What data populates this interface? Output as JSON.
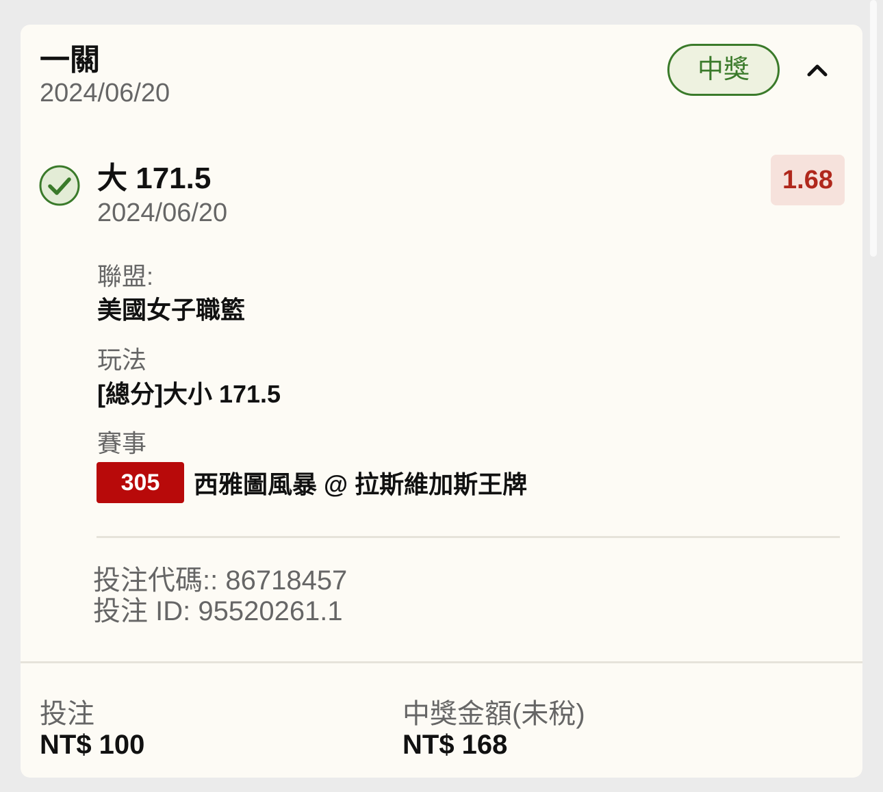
{
  "card": {
    "title": "一關",
    "date": "2024/06/20",
    "status": "中獎"
  },
  "selection": {
    "pick": "大 171.5",
    "date": "2024/06/20",
    "odds": "1.68",
    "league_label": "聯盟:",
    "league_value": "美國女子職籃",
    "market_label": "玩法",
    "market_value": "[總分]大小 171.5",
    "event_label": "賽事",
    "event_number": "305",
    "event_name": "西雅圖風暴 @ 拉斯維加斯王牌"
  },
  "meta": {
    "bet_code": "投注代碼:: 86718457",
    "bet_id": "投注 ID: 95520261.1"
  },
  "footer": {
    "stake_label": "投注",
    "stake_value": "NT$ 100",
    "payout_label": "中獎金額(未稅)",
    "payout_value": "NT$ 168"
  },
  "colors": {
    "status_green": "#3a7a2a",
    "odds_red": "#b0281c",
    "event_badge_red": "#b80a0a"
  },
  "icons": {
    "status": "check-circle-icon",
    "collapse": "chevron-up-icon"
  }
}
